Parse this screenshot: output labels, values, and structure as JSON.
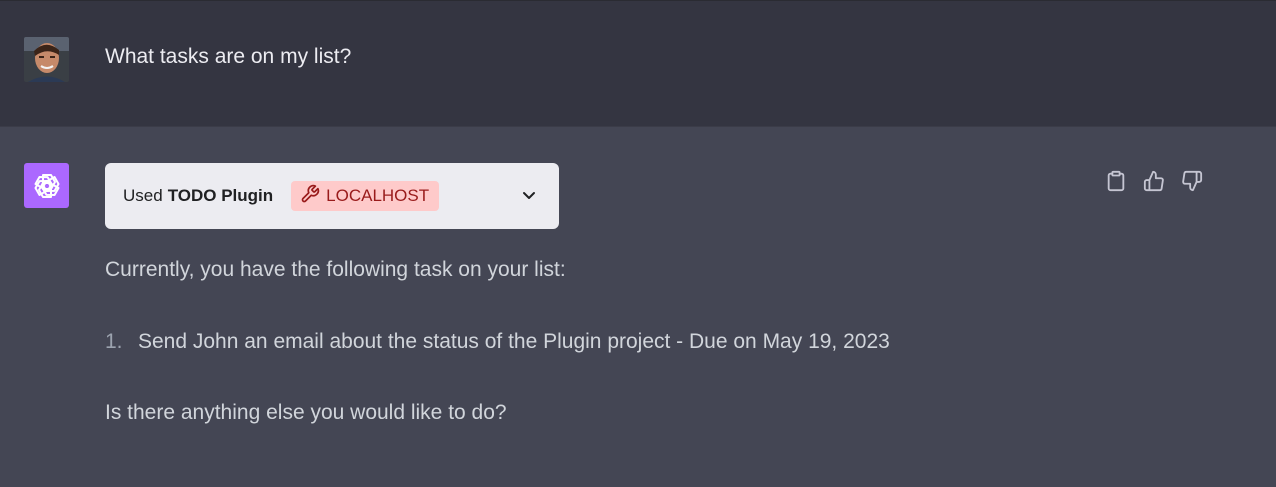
{
  "conversation": {
    "user_message": "What tasks are on my list?",
    "assistant": {
      "plugin": {
        "used_label": "Used",
        "name": "TODO Plugin",
        "badge": "LOCALHOST"
      },
      "intro": "Currently, you have the following task on your list:",
      "tasks": [
        {
          "number": "1.",
          "text": "Send John an email about the status of the Plugin project - Due on May 19, 2023"
        }
      ],
      "closing": "Is there anything else you would like to do?"
    }
  },
  "icons": {
    "assistant_avatar": "openai-logo-icon",
    "plugin_badge": "wrench-icon",
    "expand": "chevron-down-icon",
    "copy": "clipboard-icon",
    "upvote": "thumbs-up-icon",
    "downvote": "thumbs-down-icon"
  },
  "colors": {
    "user_bg": "#343541",
    "assistant_bg": "#444654",
    "assistant_avatar": "#ab68ff",
    "badge_bg": "#fecaca",
    "badge_text": "#991b1b"
  }
}
